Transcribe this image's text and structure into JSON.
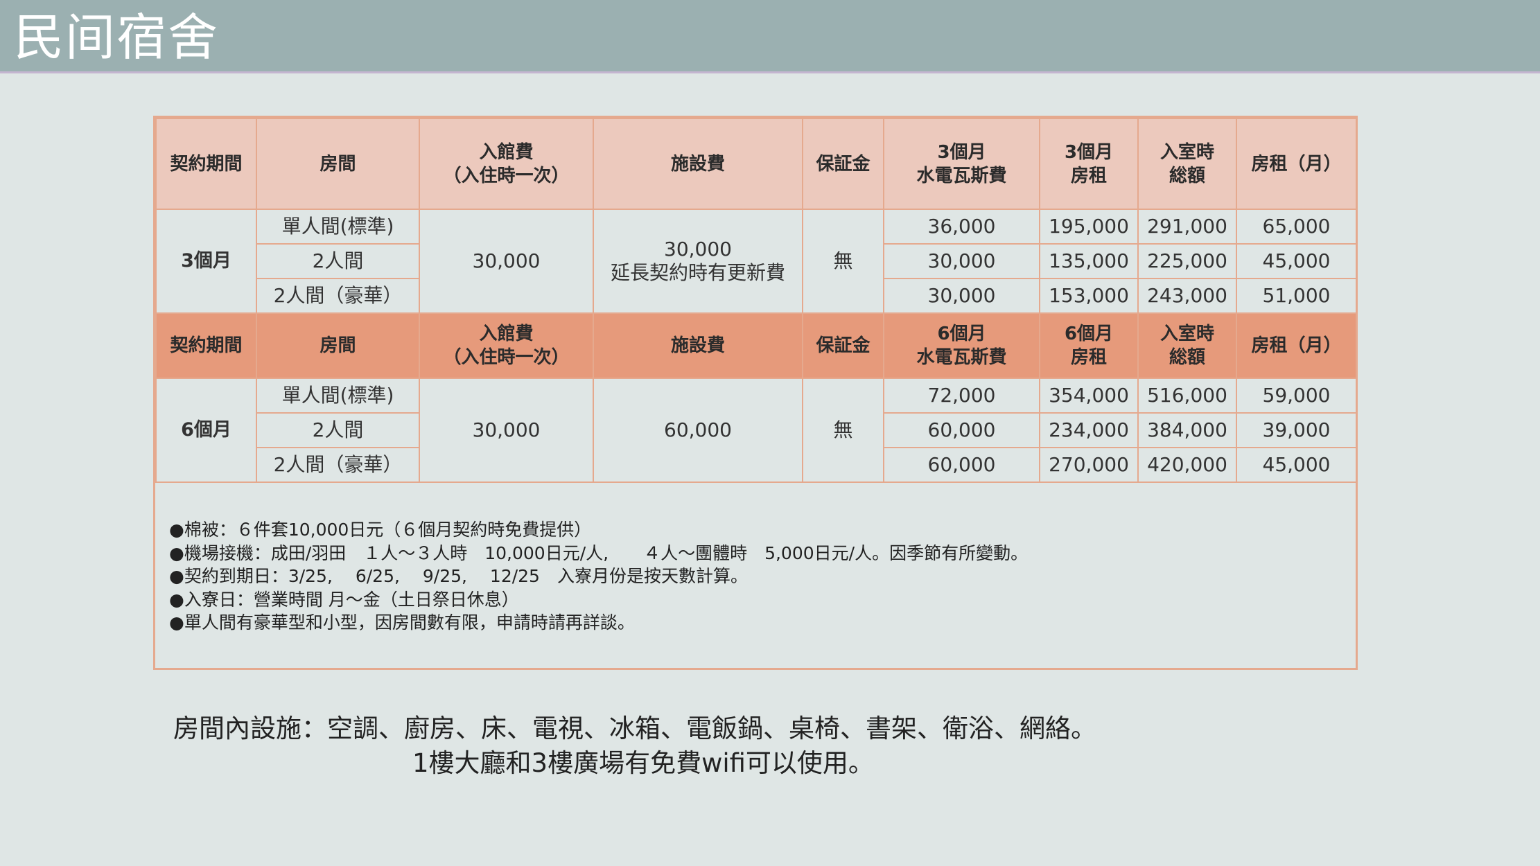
{
  "title": "民间宿舍",
  "headers_3m": [
    "契約期間",
    "房間",
    "入館費\n（入住時一次）",
    "施設費",
    "保証金",
    "3個月\n水電瓦斯費",
    "3個月\n房租",
    "入室時\n総額",
    "房租（月）"
  ],
  "headers_6m": [
    "契約期間",
    "房間",
    "入館費\n（入住時一次）",
    "施設費",
    "保証金",
    "6個月\n水電瓦斯費",
    "6個月\n房租",
    "入室時\n総額",
    "房租（月）"
  ],
  "block_3m": {
    "period": "3個月",
    "entry_fee": "30,000",
    "facility_fee": "30,000\n延長契約時有更新費",
    "deposit": "無",
    "rows": [
      {
        "room": "單人間(標準)",
        "utility": "36,000",
        "rent": "195,000",
        "total": "291,000",
        "monthly": "65,000"
      },
      {
        "room": "2人間",
        "utility": "30,000",
        "rent": "135,000",
        "total": "225,000",
        "monthly": "45,000"
      },
      {
        "room": "2人間（豪華）",
        "utility": "30,000",
        "rent": "153,000",
        "total": "243,000",
        "monthly": "51,000"
      }
    ]
  },
  "block_6m": {
    "period": "6個月",
    "entry_fee": "30,000",
    "facility_fee": "60,000",
    "deposit": "無",
    "rows": [
      {
        "room": "單人間(標準)",
        "utility": "72,000",
        "rent": "354,000",
        "total": "516,000",
        "monthly": "59,000"
      },
      {
        "room": "2人間",
        "utility": "60,000",
        "rent": "234,000",
        "total": "384,000",
        "monthly": "39,000"
      },
      {
        "room": "2人間（豪華）",
        "utility": "60,000",
        "rent": "270,000",
        "total": "420,000",
        "monthly": "45,000"
      }
    ]
  },
  "notes": [
    "●棉被：６件套10,000日元（６個月契約時免費提供）",
    "●機場接機：成田/羽田　１人～３人時　10,000日元/人,　　４人～團體時　5,000日元/人。因季節有所變動。",
    "●契約到期日：3/25,　 6/25,　 9/25,　 12/25　入寮月份是按天數計算。",
    "●入寮日：營業時間 月～金（土日祭日休息）",
    "●單人間有豪華型和小型，因房間數有限，申請時請再詳談。"
  ],
  "facilities": {
    "line1": "房間內設施：空調、廚房、床、電視、冰箱、電飯鍋、桌椅、書架、衛浴、網絡。",
    "line2": "1樓大廳和3樓廣場有免費wifi可以使用。"
  },
  "colors": {
    "header_bar": "#9bb0b1",
    "table_header_light": "#ecc9bd",
    "table_header_dark": "#e69a7b",
    "border": "#e5a98e",
    "background": "#dfe6e5"
  }
}
